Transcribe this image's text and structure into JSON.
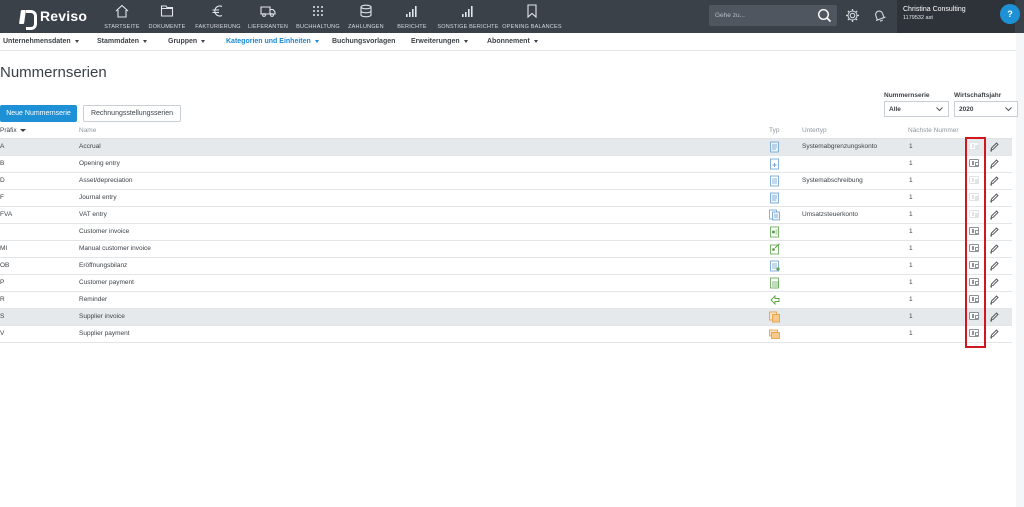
{
  "app": {
    "name": "Reviso"
  },
  "nav": [
    {
      "label": "STARTSEITE",
      "icon": "home-icon"
    },
    {
      "label": "DOKUMENTE",
      "icon": "folder-icon"
    },
    {
      "label": "FAKTURIERUNG",
      "icon": "euro-icon"
    },
    {
      "label": "LIEFERANTEN",
      "icon": "truck-icon"
    },
    {
      "label": "BUCHHALTUNG",
      "icon": "grid-icon"
    },
    {
      "label": "ZAHLUNGEN",
      "icon": "coins-icon"
    },
    {
      "label": "BERICHTE",
      "icon": "bar-chart-icon"
    },
    {
      "label": "SONSTIGE BERICHTE",
      "icon": "bar-chart-icon"
    },
    {
      "label": "OPENING BALANCES",
      "icon": "bookmark-icon"
    }
  ],
  "search": {
    "placeholder": "Gehe zu..."
  },
  "account": {
    "name": "Christina Consulting",
    "id": "1179532 ast"
  },
  "help": {
    "label": "?"
  },
  "submenu": [
    {
      "label": "Unternehmensdaten",
      "caret": true,
      "active": false
    },
    {
      "label": "Stammdaten",
      "caret": true,
      "active": false
    },
    {
      "label": "Gruppen",
      "caret": true,
      "active": false
    },
    {
      "label": "Kategorien und Einheiten",
      "caret": true,
      "active": true
    },
    {
      "label": "Buchungsvorlagen",
      "caret": false,
      "active": false
    },
    {
      "label": "Erweiterungen",
      "caret": true,
      "active": false
    },
    {
      "label": "Abonnement",
      "caret": true,
      "active": false
    }
  ],
  "page": {
    "title": "Nummernserien"
  },
  "buttons": {
    "new": "Neue Nummernserie",
    "billing": "Rechnungsstellungsserien"
  },
  "filters": {
    "series_label": "Nummernserie",
    "series_value": "Alle",
    "year_label": "Wirtschaftsjahr",
    "year_value": "2020"
  },
  "table": {
    "headers": {
      "prefix": "Präfix",
      "name": "Name",
      "type": "Typ",
      "subtype": "Untertyp",
      "next": "Nächste Nummer"
    },
    "rows": [
      {
        "prefix": "A",
        "name": "Accrual",
        "type_icon": "journal-doc-icon",
        "subtype": "Systemabgrenzungskonto",
        "next": "1",
        "shaded": true,
        "badge_faded": true
      },
      {
        "prefix": "B",
        "name": "Opening entry",
        "type_icon": "opening-doc-icon",
        "subtype": "",
        "next": "1",
        "shaded": false,
        "badge_faded": false
      },
      {
        "prefix": "D",
        "name": "Asset/depreciation",
        "type_icon": "asset-doc-icon",
        "subtype": "Systemabschreibung",
        "next": "1",
        "shaded": false,
        "badge_faded": true
      },
      {
        "prefix": "F",
        "name": "Journal entry",
        "type_icon": "journal-doc-icon",
        "subtype": "",
        "next": "1",
        "shaded": false,
        "badge_faded": true
      },
      {
        "prefix": "FVA",
        "name": "VAT entry",
        "type_icon": "vat-doc-icon",
        "subtype": "Umsatzsteuerkonto",
        "next": "1",
        "shaded": false,
        "badge_faded": true
      },
      {
        "prefix": "",
        "name": "Customer invoice",
        "type_icon": "customer-invoice-icon",
        "subtype": "",
        "next": "1",
        "shaded": false,
        "badge_faded": false
      },
      {
        "prefix": "MI",
        "name": "Manual customer invoice",
        "type_icon": "manual-invoice-icon",
        "subtype": "",
        "next": "1",
        "shaded": false,
        "badge_faded": false
      },
      {
        "prefix": "OB",
        "name": "Eröffnungsbilanz",
        "type_icon": "opening-balance-icon",
        "subtype": "",
        "next": "1",
        "shaded": false,
        "badge_faded": false
      },
      {
        "prefix": "P",
        "name": "Customer payment",
        "type_icon": "customer-payment-icon",
        "subtype": "",
        "next": "1",
        "shaded": false,
        "badge_faded": false
      },
      {
        "prefix": "R",
        "name": "Reminder",
        "type_icon": "reminder-icon",
        "subtype": "",
        "next": "1",
        "shaded": false,
        "badge_faded": false
      },
      {
        "prefix": "S",
        "name": "Supplier invoice",
        "type_icon": "supplier-invoice-icon",
        "subtype": "",
        "next": "1",
        "shaded": true,
        "badge_faded": false
      },
      {
        "prefix": "V",
        "name": "Supplier payment",
        "type_icon": "supplier-payment-icon",
        "subtype": "",
        "next": "1",
        "shaded": false,
        "badge_faded": false
      }
    ]
  },
  "colors": {
    "topbar": "#3b4149",
    "accent": "#1e91d6",
    "highlight": "#d0161f"
  }
}
